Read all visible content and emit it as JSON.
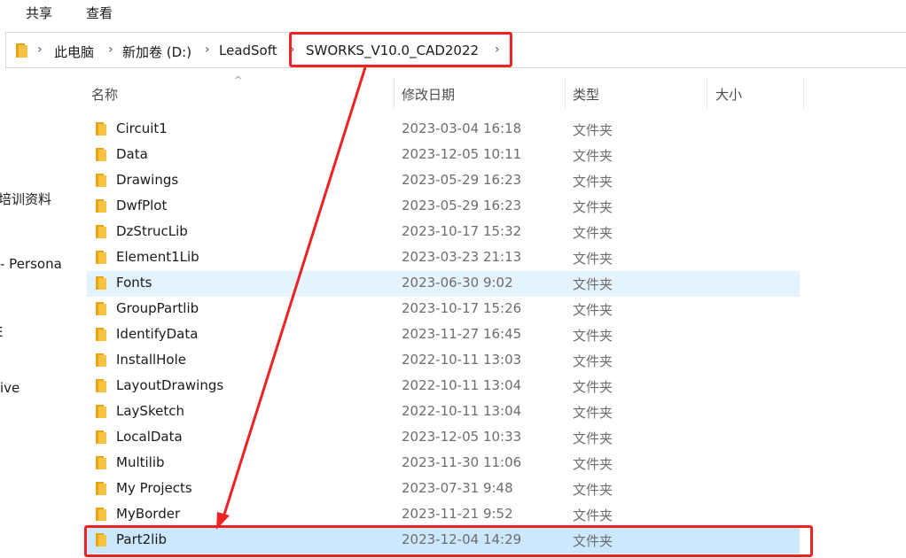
{
  "ribbon": {
    "tabs": [
      "共享",
      "查看"
    ]
  },
  "address": {
    "breadcrumbs": [
      "此电脑",
      "新加卷 (D:)",
      "LeadSoft",
      "SWORKS_V10.0_CAD2022"
    ]
  },
  "nav": {
    "items": [
      "培训资料",
      "- Persona",
      "E",
      "ive"
    ]
  },
  "columns": {
    "name": "名称",
    "modified": "修改日期",
    "type": "类型",
    "size": "大小"
  },
  "files": [
    {
      "name": "Circuit1",
      "date": "2023-03-04 16:18",
      "type": "文件夹"
    },
    {
      "name": "Data",
      "date": "2023-12-05 10:11",
      "type": "文件夹"
    },
    {
      "name": "Drawings",
      "date": "2023-05-29 16:23",
      "type": "文件夹"
    },
    {
      "name": "DwfPlot",
      "date": "2023-05-29 16:23",
      "type": "文件夹"
    },
    {
      "name": "DzStrucLib",
      "date": "2023-10-17 15:32",
      "type": "文件夹"
    },
    {
      "name": "Element1Lib",
      "date": "2023-03-23 21:13",
      "type": "文件夹"
    },
    {
      "name": "Fonts",
      "date": "2023-06-30 9:02",
      "type": "文件夹"
    },
    {
      "name": "GroupPartlib",
      "date": "2023-10-17 15:26",
      "type": "文件夹"
    },
    {
      "name": "IdentifyData",
      "date": "2023-11-27 16:45",
      "type": "文件夹"
    },
    {
      "name": "InstallHole",
      "date": "2022-10-11 13:03",
      "type": "文件夹"
    },
    {
      "name": "LayoutDrawings",
      "date": "2022-10-11 13:04",
      "type": "文件夹"
    },
    {
      "name": "LaySketch",
      "date": "2022-10-11 13:04",
      "type": "文件夹"
    },
    {
      "name": "LocalData",
      "date": "2023-12-05 10:33",
      "type": "文件夹"
    },
    {
      "name": "Multilib",
      "date": "2023-11-30 11:06",
      "type": "文件夹"
    },
    {
      "name": "My Projects",
      "date": "2023-07-31 9:48",
      "type": "文件夹"
    },
    {
      "name": "MyBorder",
      "date": "2023-11-21 9:52",
      "type": "文件夹"
    },
    {
      "name": "Part2lib",
      "date": "2023-12-04 14:29",
      "type": "文件夹"
    }
  ],
  "state": {
    "hover_row": "Fonts",
    "selected_row": "Part2lib"
  },
  "colors": {
    "annotation": "#ee2222",
    "folder": "#f5c242",
    "hover": "#e5f3ff",
    "selected": "#cce8ff"
  },
  "icons": {
    "folder": "folder-icon",
    "chevron": "chevron-right-icon",
    "sort": "sort-up-icon"
  }
}
